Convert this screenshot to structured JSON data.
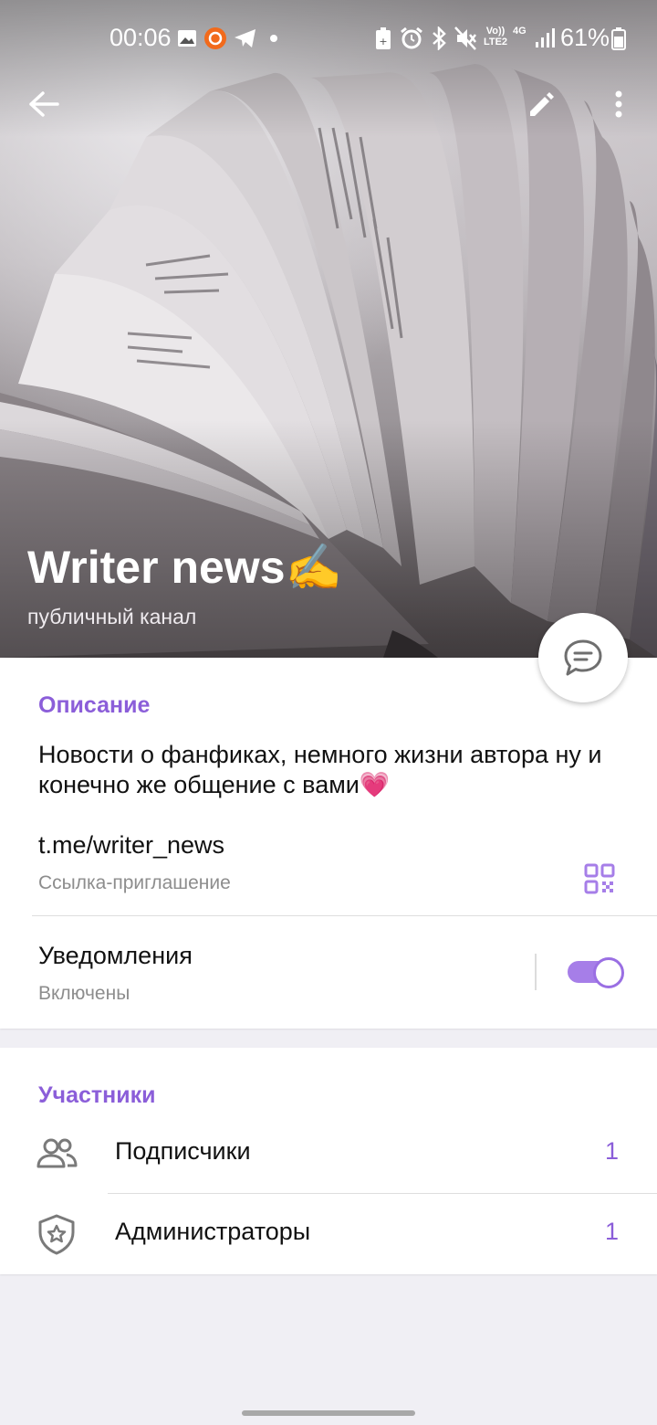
{
  "status_bar": {
    "time": "00:06",
    "battery": "61%",
    "icons": [
      "gallery-icon",
      "app-notification-icon",
      "telegram-icon",
      "dot-icon",
      "battery-saver-icon",
      "alarm-icon",
      "bluetooth-icon",
      "mute-icon",
      "volte-icon",
      "4g-icon",
      "signal-icon",
      "battery-icon"
    ],
    "volte_text": "Vo)) LTE2",
    "net_text": "4G"
  },
  "channel": {
    "name": "Writer news",
    "name_emoji": "✍",
    "subtitle": "публичный канал"
  },
  "info": {
    "section_title": "Описание",
    "description": "Новости о фанфиках, немного жизни автора ну и конечно же общение с вами💗",
    "link": "t.me/writer_news",
    "link_caption": "Ссылка-приглашение",
    "notifications_label": "Уведомления",
    "notifications_state": "Включены",
    "notifications_on": true
  },
  "members": {
    "section_title": "Участники",
    "items": [
      {
        "label": "Подписчики",
        "count": "1",
        "icon": "users-icon"
      },
      {
        "label": "Администраторы",
        "count": "1",
        "icon": "admin-shield-icon"
      }
    ]
  },
  "colors": {
    "accent": "#8b5ed9",
    "toggle_track": "#a67ee8",
    "background": "#f0eff4"
  }
}
